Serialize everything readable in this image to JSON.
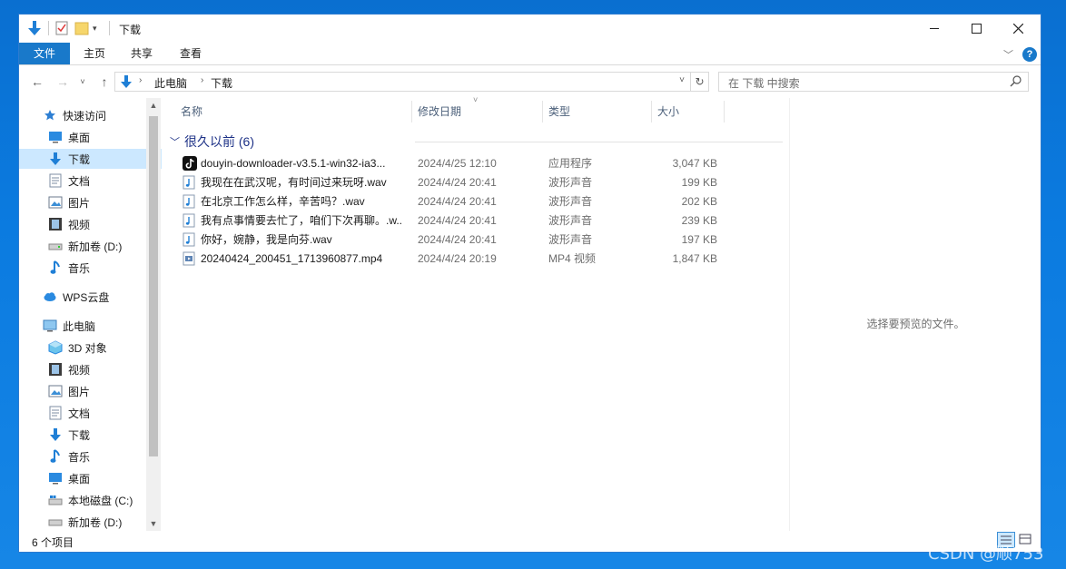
{
  "window": {
    "title": "下载",
    "controls": [
      "minimize-icon",
      "maximize-icon",
      "close-icon"
    ]
  },
  "ribbon": {
    "tabs": [
      "文件",
      "主页",
      "共享",
      "查看"
    ],
    "help": "?"
  },
  "nav": {
    "breadcrumb": [
      "此电脑",
      "下载"
    ],
    "search_placeholder": "在 下载 中搜索"
  },
  "sidebar": {
    "quick_access": "快速访问",
    "quick_items": [
      {
        "label": "桌面",
        "icon": "desktop-icon",
        "pinned": true
      },
      {
        "label": "下载",
        "icon": "download-icon",
        "pinned": true,
        "selected": true
      },
      {
        "label": "文档",
        "icon": "document-icon",
        "pinned": true
      },
      {
        "label": "图片",
        "icon": "picture-icon",
        "pinned": true
      },
      {
        "label": "视频",
        "icon": "video-icon",
        "pinned": false
      },
      {
        "label": "新加卷 (D:)",
        "icon": "drive-icon",
        "pinned": false
      },
      {
        "label": "音乐",
        "icon": "music-icon",
        "pinned": false
      }
    ],
    "wps": "WPS云盘",
    "this_pc": "此电脑",
    "pc_items": [
      {
        "label": "3D 对象",
        "icon": "3d-objects-icon"
      },
      {
        "label": "视频",
        "icon": "video-icon"
      },
      {
        "label": "图片",
        "icon": "picture-icon"
      },
      {
        "label": "文档",
        "icon": "document-icon"
      },
      {
        "label": "下载",
        "icon": "download-icon"
      },
      {
        "label": "音乐",
        "icon": "music-icon"
      },
      {
        "label": "桌面",
        "icon": "desktop-icon"
      },
      {
        "label": "本地磁盘 (C:)",
        "icon": "drive-icon"
      },
      {
        "label": "新加卷 (D:)",
        "icon": "drive-icon"
      }
    ]
  },
  "columns": {
    "name": "名称",
    "date": "修改日期",
    "type": "类型",
    "size": "大小"
  },
  "group": {
    "label": "很久以前 (6)"
  },
  "files": [
    {
      "name": "douyin-downloader-v3.5.1-win32-ia3...",
      "date": "2024/4/25 12:10",
      "type": "应用程序",
      "size": "3,047 KB",
      "icon": "tiktok-app-icon"
    },
    {
      "name": "我现在在武汉呢，有时间过来玩呀.wav",
      "date": "2024/4/24 20:41",
      "type": "波形声音",
      "size": "199 KB",
      "icon": "audio-file-icon"
    },
    {
      "name": "在北京工作怎么样，辛苦吗？.wav",
      "date": "2024/4/24 20:41",
      "type": "波形声音",
      "size": "202 KB",
      "icon": "audio-file-icon"
    },
    {
      "name": "我有点事情要去忙了，咱们下次再聊。.w...",
      "date": "2024/4/24 20:41",
      "type": "波形声音",
      "size": "239 KB",
      "icon": "audio-file-icon"
    },
    {
      "name": "你好，婉静，我是向芬.wav",
      "date": "2024/4/24 20:41",
      "type": "波形声音",
      "size": "197 KB",
      "icon": "audio-file-icon"
    },
    {
      "name": "20240424_200451_1713960877.mp4",
      "date": "2024/4/24 20:19",
      "type": "MP4 视频",
      "size": "1,847 KB",
      "icon": "video-file-icon"
    }
  ],
  "preview": {
    "text": "选择要预览的文件。"
  },
  "status": {
    "text": "6 个项目"
  },
  "watermark": "CSDN @顺753",
  "colors": {
    "accent": "#1979ca",
    "selected": "#cce8ff",
    "group": "#1e3287"
  }
}
